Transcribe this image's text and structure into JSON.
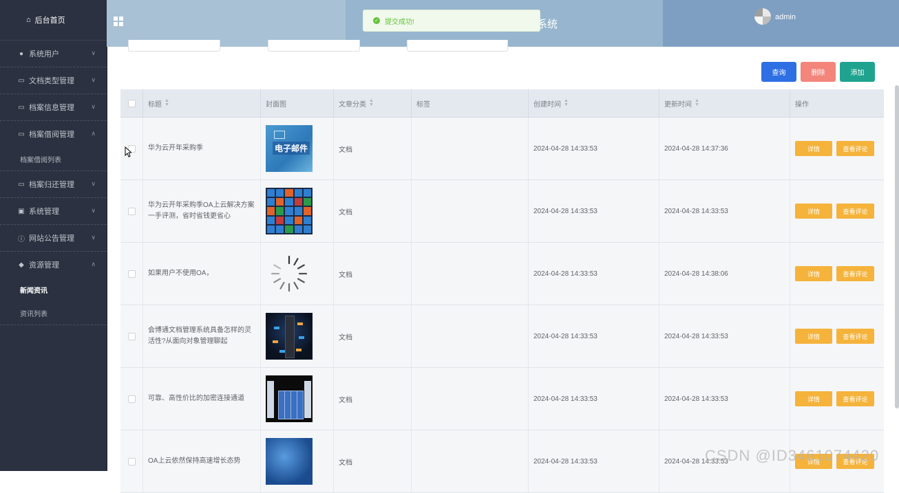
{
  "sidebar": {
    "home": "后台首页",
    "groups": [
      {
        "label": "系统用户",
        "icon": "user-icon",
        "chevron": "down"
      },
      {
        "label": "文档类型管理",
        "icon": "document-icon",
        "chevron": "down"
      },
      {
        "label": "档案信息管理",
        "icon": "document-icon",
        "chevron": "down"
      },
      {
        "label": "档案借阅管理",
        "icon": "document-icon",
        "chevron": "up",
        "sub": [
          "档案借阅列表"
        ]
      },
      {
        "label": "档案归还管理",
        "icon": "document-icon",
        "chevron": "down"
      },
      {
        "label": "系统管理",
        "icon": "image-icon",
        "chevron": "down"
      },
      {
        "label": "网站公告管理",
        "icon": "info-icon",
        "chevron": "down"
      },
      {
        "label": "资源管理",
        "icon": "location-icon",
        "chevron": "up",
        "sub": [
          "新闻资讯",
          "资讯列表"
        ]
      }
    ],
    "active_sub": "新闻资讯"
  },
  "header": {
    "title_fragment": "系统",
    "username": "admin"
  },
  "toast": {
    "message": "提交成功!",
    "type": "success",
    "color": "#67c23a"
  },
  "toolbar": {
    "query": "查询",
    "delete": "删除",
    "add": "添加"
  },
  "colors": {
    "query": "#2f6fe4",
    "delete": "#f3857b",
    "add": "#1fa38f",
    "action": "#f5b33b",
    "sidebar": "#2b3140"
  },
  "table": {
    "headers": [
      "标题",
      "封面图",
      "文章分类",
      "标签",
      "创建时间",
      "更新时间",
      "操作"
    ],
    "rows": [
      {
        "title": "华为云开年采购季",
        "cover": "email-cover",
        "category": "文档",
        "tag": "",
        "created": "2024-04-28 14:33:53",
        "updated": "2024-04-28 14:37:36"
      },
      {
        "title": "华为云开年采购季OA上云解决方案一手评测，省时省钱更省心",
        "cover": "tiles-cover",
        "category": "文档",
        "tag": "",
        "created": "2024-04-28 14:33:53",
        "updated": "2024-04-28 14:33:53"
      },
      {
        "title": "如果用户不使用OA，",
        "cover": "loading-spinner",
        "category": "文档",
        "tag": "",
        "created": "2024-04-28 14:33:53",
        "updated": "2024-04-28 14:38:06"
      },
      {
        "title": "会博通文档管理系统具备怎样的灵活性?从面向对象管理聊起",
        "cover": "dark-tech-cover",
        "category": "文档",
        "tag": "",
        "created": "2024-04-28 14:33:53",
        "updated": "2024-04-28 14:33:53"
      },
      {
        "title": "可靠、高性价比的加密连接通道",
        "cover": "books-cover",
        "category": "文档",
        "tag": "",
        "created": "2024-04-28 14:33:53",
        "updated": "2024-04-28 14:33:53"
      },
      {
        "title": "OA上云依然保持高速增长态势",
        "cover": "blue-network-cover",
        "category": "文档",
        "tag": "",
        "created": "2024-04-28 14:33:53",
        "updated": "2024-04-28 14:33:53"
      }
    ],
    "row_actions": {
      "detail": "详情",
      "comments": "查看评论"
    }
  },
  "watermark": "CSDN @ID3461074420"
}
